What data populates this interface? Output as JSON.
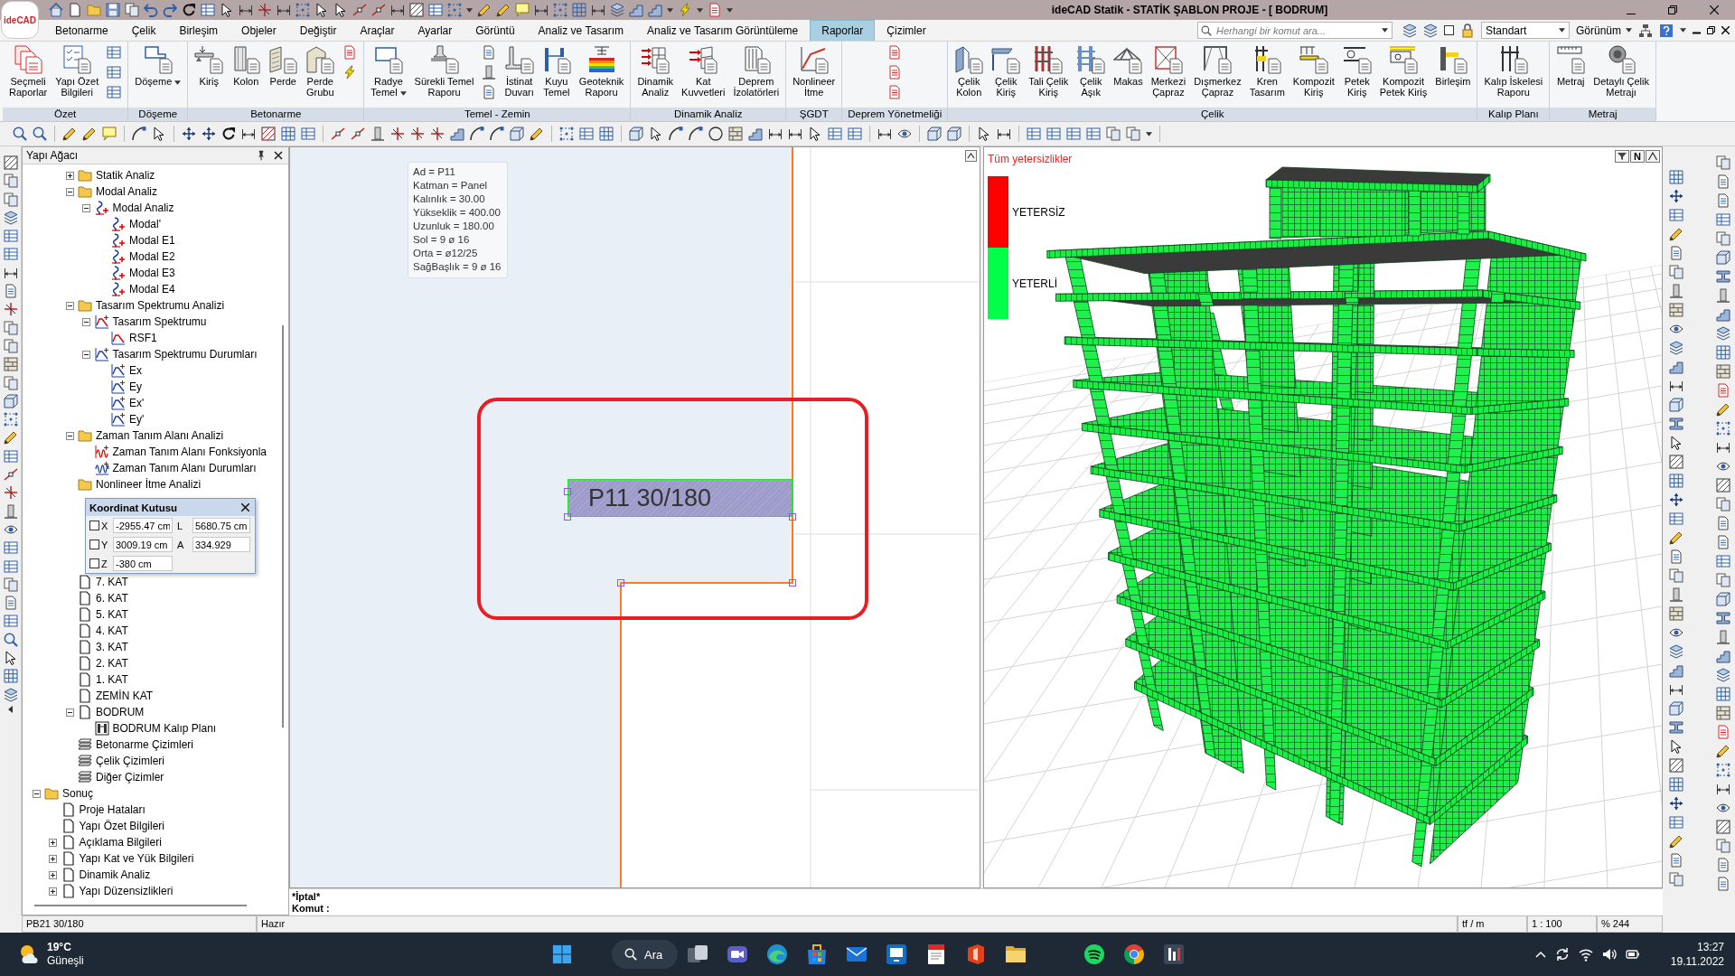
{
  "title_bar": {
    "logo": "ideCAD",
    "title": "ideCAD Statik - STATİK ŞABLON PROJE - [ BODRUM]"
  },
  "menu_bar": {
    "tabs": [
      {
        "label": "Betonarme",
        "selected": false
      },
      {
        "label": "Çelik",
        "selected": false
      },
      {
        "label": "Birleşim",
        "selected": false
      },
      {
        "label": "Objeler",
        "selected": false
      },
      {
        "label": "Değiştir",
        "selected": false
      },
      {
        "label": "Araçlar",
        "selected": false
      },
      {
        "label": "Ayarlar",
        "selected": false
      },
      {
        "label": "Görüntü",
        "selected": false
      },
      {
        "label": "Analiz ve Tasarım",
        "selected": false
      },
      {
        "label": "Analiz ve Tasarım Görüntüleme",
        "selected": false
      },
      {
        "label": "Raporlar",
        "selected": true
      },
      {
        "label": "Çizimler",
        "selected": false
      }
    ],
    "command_search": {
      "placeholder": "Herhangi bir komut ara..."
    },
    "lock_checkbox": {
      "checked": false
    },
    "style_select": {
      "value": "Standart"
    },
    "view_menu": {
      "label": "Görünüm"
    }
  },
  "ribbon": {
    "groups": [
      {
        "label": "Özet",
        "buttons": [
          {
            "kind": "large",
            "label": "Seçmeli\nRaporlar"
          },
          {
            "kind": "large",
            "label": "Yapı Özet\nBilgileri"
          },
          {
            "kind": "small"
          },
          {
            "kind": "small"
          },
          {
            "kind": "small"
          }
        ]
      },
      {
        "label": "Döşeme",
        "buttons": [
          {
            "kind": "split",
            "label": "Döşeme"
          }
        ]
      },
      {
        "label": "Betonarme",
        "buttons": [
          {
            "kind": "large",
            "label": "Kiriş"
          },
          {
            "kind": "large",
            "label": "Kolon"
          },
          {
            "kind": "large",
            "label": "Perde"
          },
          {
            "kind": "large",
            "label": "Perde\nGrubu"
          },
          {
            "kind": "small"
          },
          {
            "kind": "small"
          }
        ]
      },
      {
        "label": "Temel - Zemin",
        "buttons": [
          {
            "kind": "split",
            "label": "Radye\nTemel"
          },
          {
            "kind": "large",
            "label": "Sürekli Temel\nRaporu"
          },
          {
            "kind": "small"
          },
          {
            "kind": "small"
          },
          {
            "kind": "small"
          },
          {
            "kind": "large",
            "label": "İstinat\nDuvarı"
          },
          {
            "kind": "large",
            "label": "Kuyu\nTemel"
          },
          {
            "kind": "large",
            "label": "Geoteknik\nRaporu"
          }
        ]
      },
      {
        "label": "Dinamik Analiz",
        "buttons": [
          {
            "kind": "large",
            "label": "Dinamik\nAnaliz"
          },
          {
            "kind": "large",
            "label": "Kat\nKuvvetleri"
          },
          {
            "kind": "large",
            "label": "Deprem\nİzolatörleri"
          }
        ]
      },
      {
        "label": "ŞGDT",
        "buttons": [
          {
            "kind": "large",
            "label": "Nonlineer\nİtme"
          }
        ]
      },
      {
        "label": "Deprem Yönetmeliği",
        "buttons": [
          {
            "kind": "small"
          },
          {
            "kind": "small"
          },
          {
            "kind": "small"
          }
        ]
      },
      {
        "label": "Çelik",
        "buttons": [
          {
            "kind": "large",
            "label": "Çelik\nKolon"
          },
          {
            "kind": "large",
            "label": "Çelik\nKiriş"
          },
          {
            "kind": "large",
            "label": "Tali Çelik\nKiriş"
          },
          {
            "kind": "large",
            "label": "Çelik\nAşık"
          },
          {
            "kind": "large",
            "label": "Makas"
          },
          {
            "kind": "large",
            "label": "Merkezi\nÇapraz"
          },
          {
            "kind": "large",
            "label": "Dışmerkez\nÇapraz"
          },
          {
            "kind": "large",
            "label": "Kren\nTasarım"
          },
          {
            "kind": "large",
            "label": "Kompozit\nKiriş"
          },
          {
            "kind": "large",
            "label": "Petek\nKiriş"
          },
          {
            "kind": "large",
            "label": "Kompozit\nPetek Kiriş"
          },
          {
            "kind": "large",
            "label": "Birleşim"
          }
        ]
      },
      {
        "label": "Kalıp Planı",
        "buttons": [
          {
            "kind": "large",
            "label": "Kalıp İskelesi\nRaporu"
          }
        ]
      },
      {
        "label": "Metraj",
        "buttons": [
          {
            "kind": "large",
            "label": "Metraj"
          },
          {
            "kind": "large",
            "label": "Detaylı Çelik\nMetrajı"
          }
        ]
      }
    ]
  },
  "structure_tree": {
    "title": "Yapı Ağacı",
    "upper": [
      {
        "children": [
          {
            "children": [
              {
                "label": "Statik Analiz",
                "kind": "folder",
                "expanded": false
              },
              {
                "label": "Modal Analiz",
                "kind": "folder",
                "expanded": true,
                "children": [
                  {
                    "label": "Modal Analiz",
                    "kind": "modal",
                    "expanded": true,
                    "children": [
                      {
                        "label": "Modal'",
                        "kind": "modal"
                      },
                      {
                        "label": "Modal E1",
                        "kind": "modal"
                      },
                      {
                        "label": "Modal E2",
                        "kind": "modal"
                      },
                      {
                        "label": "Modal E3",
                        "kind": "modal"
                      },
                      {
                        "label": "Modal E4",
                        "kind": "modal"
                      }
                    ]
                  }
                ]
              },
              {
                "label": "Tasarım Spektrumu Analizi",
                "kind": "folder",
                "expanded": true,
                "children": [
                  {
                    "label": "Tasarım Spektrumu",
                    "kind": "spectrum",
                    "expanded": true,
                    "children": [
                      {
                        "label": "RSF1",
                        "kind": "spectrum-function"
                      }
                    ]
                  },
                  {
                    "label": "Tasarım Spektrumu Durumları",
                    "kind": "spectrum-case",
                    "expanded": true,
                    "children": [
                      {
                        "label": "Ex",
                        "kind": "spectrum-case"
                      },
                      {
                        "label": "Ey",
                        "kind": "spectrum-case"
                      },
                      {
                        "label": "Ex'",
                        "kind": "spectrum-case"
                      },
                      {
                        "label": "Ey'",
                        "kind": "spectrum-case"
                      }
                    ]
                  }
                ]
              },
              {
                "label": "Zaman Tanım Alanı Analizi",
                "kind": "folder",
                "expanded": true,
                "children": [
                  {
                    "label": "Zaman Tanım Alanı Fonksiyonla",
                    "kind": "time-function"
                  },
                  {
                    "label": "Zaman Tanım Alanı Durumları",
                    "kind": "time-case"
                  }
                ]
              },
              {
                "label": "Nonlineer İtme Analizi",
                "kind": "folder"
              }
            ]
          }
        ]
      }
    ],
    "lower": [
      {
        "children": [
          {
            "children": [
              {
                "label": "7. KAT",
                "kind": "page"
              },
              {
                "label": "6. KAT",
                "kind": "page"
              },
              {
                "label": "5. KAT",
                "kind": "page"
              },
              {
                "label": "4. KAT",
                "kind": "page"
              },
              {
                "label": "3. KAT",
                "kind": "page"
              },
              {
                "label": "2. KAT",
                "kind": "page"
              },
              {
                "label": "1. KAT",
                "kind": "page"
              },
              {
                "label": "ZEMİN KAT",
                "kind": "page"
              },
              {
                "label": "BODRUM",
                "kind": "page",
                "expanded": true,
                "children": [
                  {
                    "label": "BODRUM Kalıp Planı",
                    "kind": "plan"
                  }
                ]
              },
              {
                "label": "Betonarme Çizimleri",
                "kind": "drawings"
              },
              {
                "label": "Çelik Çizimleri",
                "kind": "drawings"
              },
              {
                "label": "Diğer Çizimler",
                "kind": "drawings"
              }
            ]
          }
        ]
      },
      {
        "label": "Sonuç",
        "kind": "folder",
        "expanded": true,
        "children": [
          {
            "label": "Proje Hataları",
            "kind": "page"
          },
          {
            "label": "Yapı Özet Bilgileri",
            "kind": "page"
          },
          {
            "label": "Açıklama Bilgileri",
            "kind": "page",
            "expanded": false
          },
          {
            "label": "Yapı Kat ve Yük Bilgileri",
            "kind": "page",
            "expanded": false
          },
          {
            "label": "Dinamik Analiz",
            "kind": "page",
            "expanded": false
          },
          {
            "label": "Yapı Düzensizlikleri",
            "kind": "page",
            "expanded": false
          }
        ]
      }
    ]
  },
  "coordinate_box": {
    "title": "Koordinat Kutusu",
    "fields": [
      {
        "axis": "X",
        "checked": false,
        "value": "-2955.47 cm",
        "label": "L",
        "reading": "5680.75 cm"
      },
      {
        "axis": "Y",
        "checked": false,
        "value": "3009.19 cm",
        "label": "A",
        "reading": "334.929"
      },
      {
        "axis": "Z",
        "checked": false,
        "value": "-380 cm"
      }
    ]
  },
  "canvas": {
    "properties": [
      "Ad = P11",
      "Katman = Panel",
      "Kalınlık = 30.00",
      "Yükseklik = 400.00",
      "Uzunluk = 180.00",
      "Sol = 9 ø 16",
      "Orta = ø12/25",
      "SağBaşlık = 9 ø 16"
    ],
    "panel_label": "P11 30/180"
  },
  "view_3d": {
    "legend": {
      "title": "Tüm yetersizlikler",
      "items": [
        {
          "label": "YETERSİZ",
          "color": "#ff0000"
        },
        {
          "label": "YETERLİ",
          "color": "#00ff48"
        }
      ]
    },
    "letter_button": "N"
  },
  "command_line": {
    "lines": [
      "*İptal*",
      "Komut :"
    ]
  },
  "status_bar": {
    "cells": [
      "PB21 30/180",
      "Hazır",
      "tf / m",
      "1 : 100",
      "% 244"
    ]
  },
  "taskbar": {
    "weather": {
      "temperature": "19°C",
      "condition": "Güneşli"
    },
    "search": {
      "label": "Ara"
    },
    "clock": {
      "time": "13:27",
      "date": "19.11.2022"
    }
  }
}
